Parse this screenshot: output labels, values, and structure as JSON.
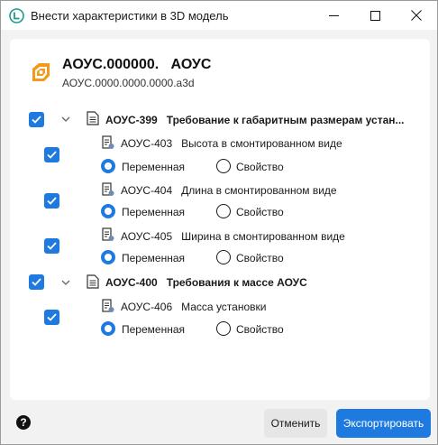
{
  "window": {
    "title": "Внести характеристики в 3D модель",
    "icons": {
      "app": "app-logo-icon",
      "minimize": "minimize-icon",
      "maximize": "maximize-icon",
      "close": "close-icon"
    }
  },
  "header": {
    "title": "АОУС.000000.   АОУС",
    "subtitle": "АОУС.0000.0000.0000.a3d",
    "icon": "3d-model-icon"
  },
  "tree": {
    "groups": [
      {
        "code": "АОУС-399",
        "label": "Требование к габаритным размерам устан...",
        "checked": true,
        "expanded": true,
        "items": [
          {
            "code": "АОУС-403",
            "label": "Высота в смонтированном виде",
            "checked": true,
            "option_variable": "Переменная",
            "option_property": "Свойство",
            "selected": "variable"
          },
          {
            "code": "АОУС-404",
            "label": "Длина в смонтированном виде",
            "checked": true,
            "option_variable": "Переменная",
            "option_property": "Свойство",
            "selected": "variable"
          },
          {
            "code": "АОУС-405",
            "label": "Ширина в смонтированном виде",
            "checked": true,
            "option_variable": "Переменная",
            "option_property": "Свойство",
            "selected": "variable"
          }
        ]
      },
      {
        "code": "АОУС-400",
        "label": "Требования к массе АОУС",
        "checked": true,
        "expanded": true,
        "items": [
          {
            "code": "АОУС-406",
            "label": "Масса установки",
            "checked": true,
            "option_variable": "Переменная",
            "option_property": "Свойство",
            "selected": "variable"
          }
        ]
      }
    ]
  },
  "footer": {
    "help": "?",
    "cancel_label": "Отменить",
    "export_label": "Экспортировать"
  },
  "colors": {
    "accent": "#1f7ae0",
    "background": "#f2f2f2",
    "card": "#ffffff"
  }
}
